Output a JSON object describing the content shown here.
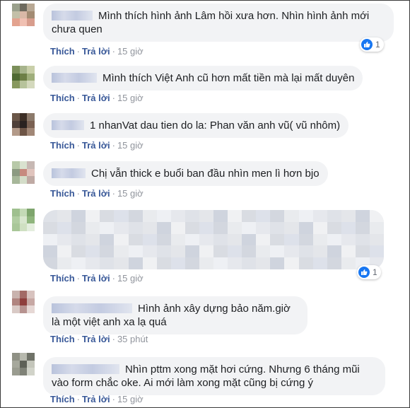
{
  "comments": [
    {
      "name_blur_width": 58,
      "text": "Mình thích hình ảnh Lâm hồi xưa hơn. Nhìn hình ảnh mới chưa quen",
      "like": "Thích",
      "reply": "Trả lời",
      "time": "15 giờ",
      "reactions": "1",
      "avatar_colors": [
        "#9aa08c",
        "#6e6a5e",
        "#b8a894",
        "#c3c0a8",
        "#d9b8a7",
        "#a38b73",
        "#e3a38f",
        "#f0c0b2",
        "#d89d8d"
      ]
    },
    {
      "name_blur_width": 64,
      "text": "Mình thích Việt Anh cũ hơn mất tiền mà lại mất duyên",
      "like": "Thích",
      "reply": "Trả lời",
      "time": "15 giờ",
      "avatar_colors": [
        "#7b8f5a",
        "#a7b48c",
        "#c9cfa9",
        "#4f6a33",
        "#6d7f46",
        "#9fae7b",
        "#88995f",
        "#b7c39b",
        "#d4d9bd"
      ]
    },
    {
      "name_blur_width": 46,
      "text": "1 nhanVat dau tien do la: Phan văn anh vũ( vũ nhôm)",
      "like": "Thích",
      "reply": "Trả lời",
      "time": "15 giờ",
      "avatar_colors": [
        "#6a5648",
        "#3d2f26",
        "#8c7a6b",
        "#4f4039",
        "#2a2220",
        "#7a6152",
        "#b39a89",
        "#6e5546",
        "#a18776"
      ]
    },
    {
      "name_blur_width": 48,
      "text": "Chị vẫn thick e buổi ban đầu nhìn men lì hơn bjo",
      "like": "Thích",
      "reply": "Trả lời",
      "time": "15 giờ",
      "avatar_colors": [
        "#b8c9a9",
        "#d9e2cf",
        "#c7b8b3",
        "#8c9a82",
        "#c78a7f",
        "#e0c4bd",
        "#a7b79a",
        "#d4ddc9",
        "#bfaaa4"
      ]
    },
    {
      "blurred": true,
      "like": "Thích",
      "reply": "Trả lời",
      "time": "15 giờ",
      "reactions": "1",
      "avatar_colors": [
        "#9fc08f",
        "#c4dab6",
        "#7ea56d",
        "#b1cda2",
        "#d8e6ce",
        "#8fb57d",
        "#a9c799",
        "#cfe0c2",
        "#e4eede"
      ]
    },
    {
      "name_blur_width": 114,
      "text": "Hình ảnh xây dựng bảo năm.giờ là một việt anh xa lạ quá",
      "like": "Thích",
      "reply": "Trả lời",
      "time": "35 phút",
      "avatar_colors": [
        "#c9b3ae",
        "#a36a66",
        "#d8c3bf",
        "#b08580",
        "#8e3e3c",
        "#c7a8a4",
        "#d9cac6",
        "#b79390",
        "#e6d8d5"
      ]
    },
    {
      "name_blur_width": 96,
      "text": "Nhìn pttm xong mặt hơi cứng. Nhưng 6 tháng mũi vào form chắc oke. Ai mới làm xong mặt cũng bị cứng ý",
      "like": "Thích",
      "reply": "Trả lời",
      "time": "15 giờ",
      "avatar_colors": [
        "#8f9185",
        "#b7b9ae",
        "#6f7268",
        "#a6a89c",
        "#5e6157",
        "#c4c6bb",
        "#9a9c90",
        "#7f8277",
        "#d1d3c9"
      ]
    }
  ]
}
